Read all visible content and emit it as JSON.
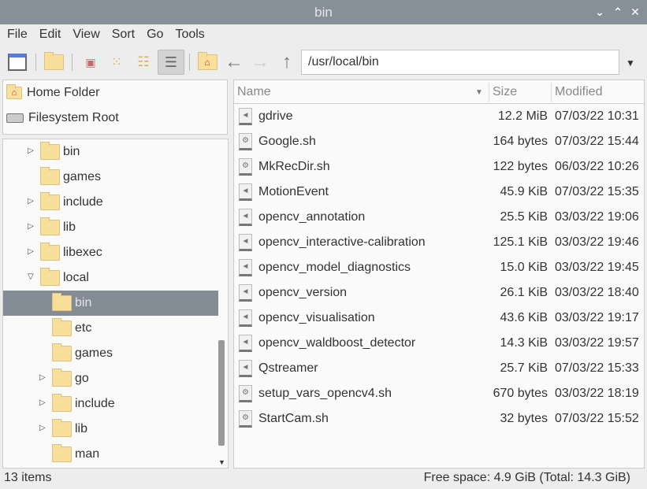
{
  "window": {
    "title": "bin"
  },
  "menu": [
    "File",
    "Edit",
    "View",
    "Sort",
    "Go",
    "Tools"
  ],
  "toolbar": {
    "path": "/usr/local/bin"
  },
  "places": [
    {
      "label": "Home Folder",
      "icon": "home-folder-icon"
    },
    {
      "label": "Filesystem Root",
      "icon": "drive-icon"
    }
  ],
  "tree": [
    {
      "label": "bin",
      "level": 1,
      "expander": "collapsed"
    },
    {
      "label": "games",
      "level": 1,
      "expander": "none"
    },
    {
      "label": "include",
      "level": 1,
      "expander": "collapsed"
    },
    {
      "label": "lib",
      "level": 1,
      "expander": "collapsed"
    },
    {
      "label": "libexec",
      "level": 1,
      "expander": "collapsed"
    },
    {
      "label": "local",
      "level": 1,
      "expander": "expanded"
    },
    {
      "label": "bin",
      "level": 2,
      "expander": "none",
      "selected": true
    },
    {
      "label": "etc",
      "level": 2,
      "expander": "none"
    },
    {
      "label": "games",
      "level": 2,
      "expander": "none"
    },
    {
      "label": "go",
      "level": 2,
      "expander": "collapsed"
    },
    {
      "label": "include",
      "level": 2,
      "expander": "collapsed"
    },
    {
      "label": "lib",
      "level": 2,
      "expander": "collapsed"
    },
    {
      "label": "man",
      "level": 2,
      "expander": "none"
    }
  ],
  "columns": {
    "name": "Name",
    "size": "Size",
    "modified": "Modified"
  },
  "files": [
    {
      "name": "gdrive",
      "size": "12.2 MiB",
      "modified": "07/03/22 10:31",
      "type": "executable"
    },
    {
      "name": "Google.sh",
      "size": "164 bytes",
      "modified": "07/03/22 15:44",
      "type": "script"
    },
    {
      "name": "MkRecDir.sh",
      "size": "122 bytes",
      "modified": "06/03/22 10:26",
      "type": "script"
    },
    {
      "name": "MotionEvent",
      "size": "45.9 KiB",
      "modified": "07/03/22 15:35",
      "type": "executable"
    },
    {
      "name": "opencv_annotation",
      "size": "25.5 KiB",
      "modified": "03/03/22 19:06",
      "type": "executable"
    },
    {
      "name": "opencv_interactive-calibration",
      "size": "125.1 KiB",
      "modified": "03/03/22 19:46",
      "type": "executable"
    },
    {
      "name": "opencv_model_diagnostics",
      "size": "15.0 KiB",
      "modified": "03/03/22 19:45",
      "type": "executable"
    },
    {
      "name": "opencv_version",
      "size": "26.1 KiB",
      "modified": "03/03/22 18:40",
      "type": "executable"
    },
    {
      "name": "opencv_visualisation",
      "size": "43.6 KiB",
      "modified": "03/03/22 19:17",
      "type": "executable"
    },
    {
      "name": "opencv_waldboost_detector",
      "size": "14.3 KiB",
      "modified": "03/03/22 19:57",
      "type": "executable"
    },
    {
      "name": "Qstreamer",
      "size": "25.7 KiB",
      "modified": "07/03/22 15:33",
      "type": "executable"
    },
    {
      "name": "setup_vars_opencv4.sh",
      "size": "670 bytes",
      "modified": "03/03/22 18:19",
      "type": "script"
    },
    {
      "name": "StartCam.sh",
      "size": "32 bytes",
      "modified": "07/03/22 15:52",
      "type": "script"
    }
  ],
  "status": {
    "items": "13 items",
    "free": "Free space: 4.9 GiB (Total: 14.3 GiB)"
  }
}
